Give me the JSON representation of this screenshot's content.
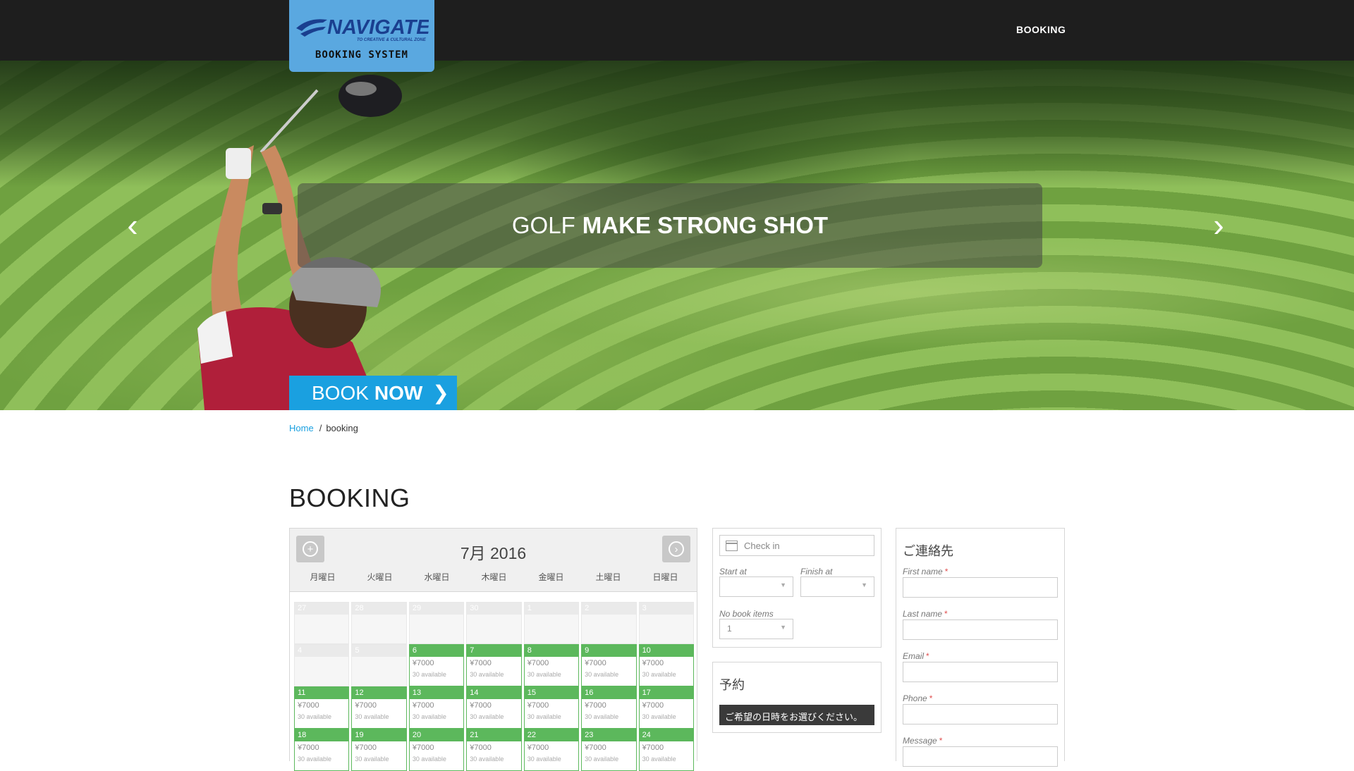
{
  "brand": {
    "logo_text": "NAVIGATE",
    "logo_tagline": "TO CREATIVE & CULTURAL ZONE",
    "subtitle": "BOOKING SYSTEM"
  },
  "nav": {
    "booking": "BOOKING"
  },
  "hero": {
    "caption_light": "GOLF",
    "caption_bold": "MAKE STRONG SHOT",
    "book_light": "BOOK",
    "book_bold": "NOW",
    "prev_arrow": "‹",
    "next_arrow": "›"
  },
  "breadcrumb": {
    "home": "Home",
    "separator": "/",
    "current": "booking"
  },
  "page_title": "BOOKING",
  "calendar": {
    "month_label": "7月 2016",
    "weekdays": [
      "月曜日",
      "火曜日",
      "水曜日",
      "木曜日",
      "金曜日",
      "土曜日",
      "日曜日"
    ],
    "days": [
      {
        "num": "27",
        "avail": false
      },
      {
        "num": "28",
        "avail": false
      },
      {
        "num": "29",
        "avail": false
      },
      {
        "num": "30",
        "avail": false
      },
      {
        "num": "1",
        "avail": false
      },
      {
        "num": "2",
        "avail": false
      },
      {
        "num": "3",
        "avail": false
      },
      {
        "num": "4",
        "avail": false
      },
      {
        "num": "5",
        "avail": false
      },
      {
        "num": "6",
        "avail": true
      },
      {
        "num": "7",
        "avail": true
      },
      {
        "num": "8",
        "avail": true
      },
      {
        "num": "9",
        "avail": true
      },
      {
        "num": "10",
        "avail": true
      },
      {
        "num": "11",
        "avail": true
      },
      {
        "num": "12",
        "avail": true
      },
      {
        "num": "13",
        "avail": true
      },
      {
        "num": "14",
        "avail": true
      },
      {
        "num": "15",
        "avail": true
      },
      {
        "num": "16",
        "avail": true
      },
      {
        "num": "17",
        "avail": true
      },
      {
        "num": "18",
        "avail": true
      },
      {
        "num": "19",
        "avail": true
      },
      {
        "num": "20",
        "avail": true
      },
      {
        "num": "21",
        "avail": true
      },
      {
        "num": "22",
        "avail": true
      },
      {
        "num": "23",
        "avail": true
      },
      {
        "num": "24",
        "avail": true
      }
    ],
    "price": "¥7000",
    "availability": "30 available"
  },
  "dates_form": {
    "checkin_placeholder": "Check in",
    "start_label": "Start at",
    "finish_label": "Finish at",
    "start_value": "",
    "finish_value": "",
    "items_label": "No book items",
    "items_value": "1"
  },
  "reservation": {
    "title": "予約",
    "message": "ご希望の日時をお選びください。"
  },
  "contact": {
    "title": "ご連絡先",
    "fields": [
      {
        "label": "First name",
        "req": "*"
      },
      {
        "label": "Last name",
        "req": "*"
      },
      {
        "label": "Email",
        "req": "*"
      },
      {
        "label": "Phone",
        "req": "*"
      },
      {
        "label": "Message",
        "req": "*"
      }
    ]
  },
  "colors": {
    "accent": "#1aa0e0",
    "available": "#5cb85c",
    "topbar": "#1e1e1e",
    "logo_bg": "#5aa8e0"
  }
}
